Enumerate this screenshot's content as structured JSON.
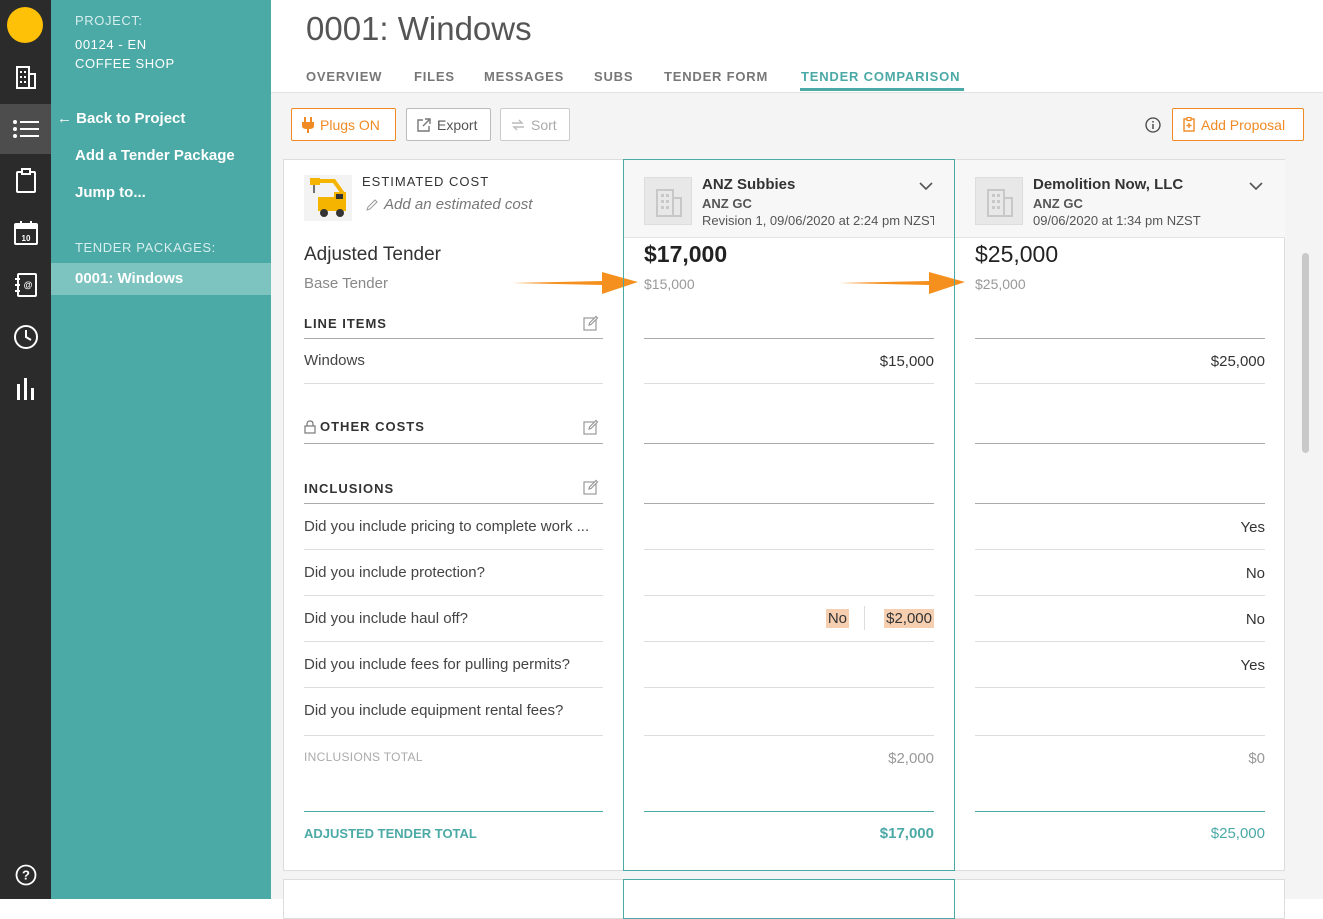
{
  "rail": {
    "icons": [
      "building-icon",
      "list-icon",
      "clipboard-icon",
      "calendar-icon",
      "contacts-icon",
      "clock-icon",
      "chart-icon",
      "help-icon"
    ],
    "calendar_day": "10"
  },
  "nav": {
    "project_label": "PROJECT:",
    "project_line1": "00124 - EN",
    "project_line2": "COFFEE SHOP",
    "back": "Back to Project",
    "add_package": "Add a Tender Package",
    "jump": "Jump to...",
    "packages_label": "TENDER PACKAGES:",
    "active_package": "0001: Windows"
  },
  "header": {
    "title": "0001: Windows",
    "tabs": [
      "OVERVIEW",
      "FILES",
      "MESSAGES",
      "SUBS",
      "TENDER FORM",
      "TENDER COMPARISON"
    ]
  },
  "toolbar": {
    "plugs": "Plugs ON",
    "export": "Export",
    "sort": "Sort",
    "add_proposal": "Add Proposal"
  },
  "estimate": {
    "label": "ESTIMATED COST",
    "placeholder": "Add an estimated cost"
  },
  "rows": {
    "adjusted_tender": "Adjusted Tender",
    "base_tender": "Base Tender",
    "line_items": "LINE ITEMS",
    "windows": "Windows",
    "other_costs": "OTHER COSTS",
    "inclusions": "INCLUSIONS",
    "q1": "Did you include pricing to complete work ...",
    "q2": "Did you include protection?",
    "q3": "Did you include haul off?",
    "q4": "Did you include fees for pulling permits?",
    "q5": "Did you include equipment rental fees?",
    "inclusions_total": "INCLUSIONS TOTAL",
    "adjusted_total": "ADJUSTED TENDER TOTAL"
  },
  "bidders": [
    {
      "name": "ANZ Subbies",
      "gc": "ANZ GC",
      "revision": "Revision 1, 09/06/2020 at 2:24 pm NZST",
      "adjusted": "$17,000",
      "base": "$15,000",
      "windows": "$15,000",
      "q1": "",
      "q2": "",
      "q3": "No",
      "q3_amount": "$2,000",
      "q4": "",
      "q5": "",
      "inclusions_total": "$2,000",
      "adjusted_total": "$17,000"
    },
    {
      "name": "Demolition Now, LLC",
      "gc": "ANZ GC",
      "revision": "09/06/2020 at 1:34 pm NZST",
      "adjusted": "$25,000",
      "base": "$25,000",
      "windows": "$25,000",
      "q1": "Yes",
      "q2": "No",
      "q3": "No",
      "q3_amount": "",
      "q4": "Yes",
      "q5": "",
      "inclusions_total": "$0",
      "adjusted_total": "$25,000"
    }
  ],
  "colors": {
    "teal": "#4ba9a6",
    "orange": "#f08a24",
    "rail": "#2b2b2b",
    "highlight": "#f6cfb0"
  }
}
